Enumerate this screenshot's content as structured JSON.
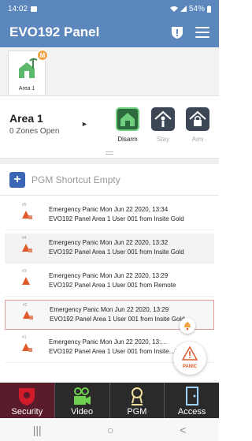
{
  "status": {
    "time": "14:02",
    "battery": "54%"
  },
  "header": {
    "title": "EVO192 Panel"
  },
  "area_tab": {
    "label": "Area 1",
    "badge": "M"
  },
  "area": {
    "name": "Area 1",
    "zones": "0 Zones Open"
  },
  "modes": [
    {
      "label": "Disarm",
      "active": true
    },
    {
      "label": "Stay",
      "active": false
    },
    {
      "label": "Arm",
      "active": false
    }
  ],
  "pgm": {
    "text": "PGM Shortcut Empty"
  },
  "events": [
    {
      "num": "#5",
      "line1": "Emergency Panic Mon Jun 22 2020, 13:34",
      "line2": "EVO192 Panel Area 1 User 001 from Insite Gold"
    },
    {
      "num": "#4",
      "line1": "Emergency Panic Mon Jun 22 2020, 13:32",
      "line2": "EVO192 Panel Area 1 User 001 from Insite Gold"
    },
    {
      "num": "#3",
      "line1": "Emergency Panic Mon Jun 22 2020, 13:29",
      "line2": "EVO192 Panel Area 1 User 001 from Remote"
    },
    {
      "num": "#2",
      "line1": "Emergency Panic Mon Jun 22 2020, 13:29",
      "line2": "EVO192 Panel Area 1 User 001 from Insite Gold"
    },
    {
      "num": "#1",
      "line1": "Emergency Panic Mon Jun 22 2020, 13:…",
      "line2": "EVO192 Panel Area 1 User 001 from Insite…ld"
    }
  ],
  "panic": {
    "label": "PANIC"
  },
  "nav": [
    {
      "label": "Security"
    },
    {
      "label": "Video"
    },
    {
      "label": "PGM"
    },
    {
      "label": "Access"
    }
  ],
  "sysnav": {
    "recents": "|||",
    "home": "○",
    "back": "<"
  },
  "colors": {
    "header": "#5b87bd",
    "accent": "#3b66b5",
    "alarm": "#e05a2c",
    "nav_active": "#5a1b2a"
  }
}
